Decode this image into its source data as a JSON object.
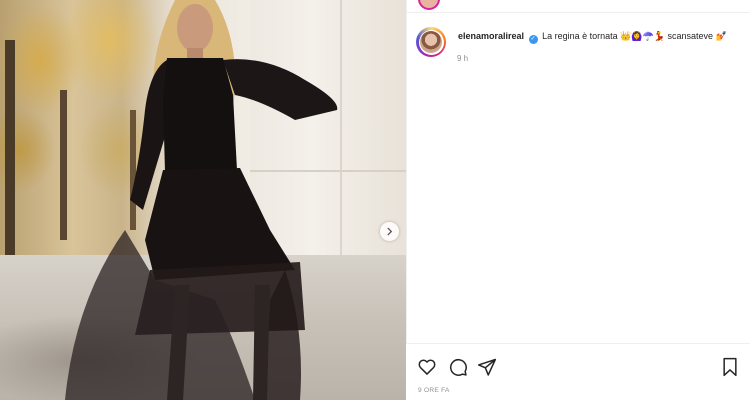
{
  "post": {
    "username": "elenamoralireal",
    "caption": "La regina è tornata",
    "caption_suffix": "scansateve",
    "caption_emojis_1": "👑🙆‍♀️☂️💃",
    "caption_emoji_2": "💅",
    "time_ago": "9 h",
    "timestamp_label": "9 ORE FA"
  },
  "icons": {
    "like": "heart-icon",
    "comment": "comment-icon",
    "share": "share-icon",
    "save": "bookmark-icon",
    "next": "chevron-right-icon",
    "verified": "verified-badge-icon"
  },
  "colors": {
    "verified": "#3897f0",
    "text_primary": "#262626",
    "text_secondary": "#8e8e8e",
    "divider": "#efefef"
  }
}
